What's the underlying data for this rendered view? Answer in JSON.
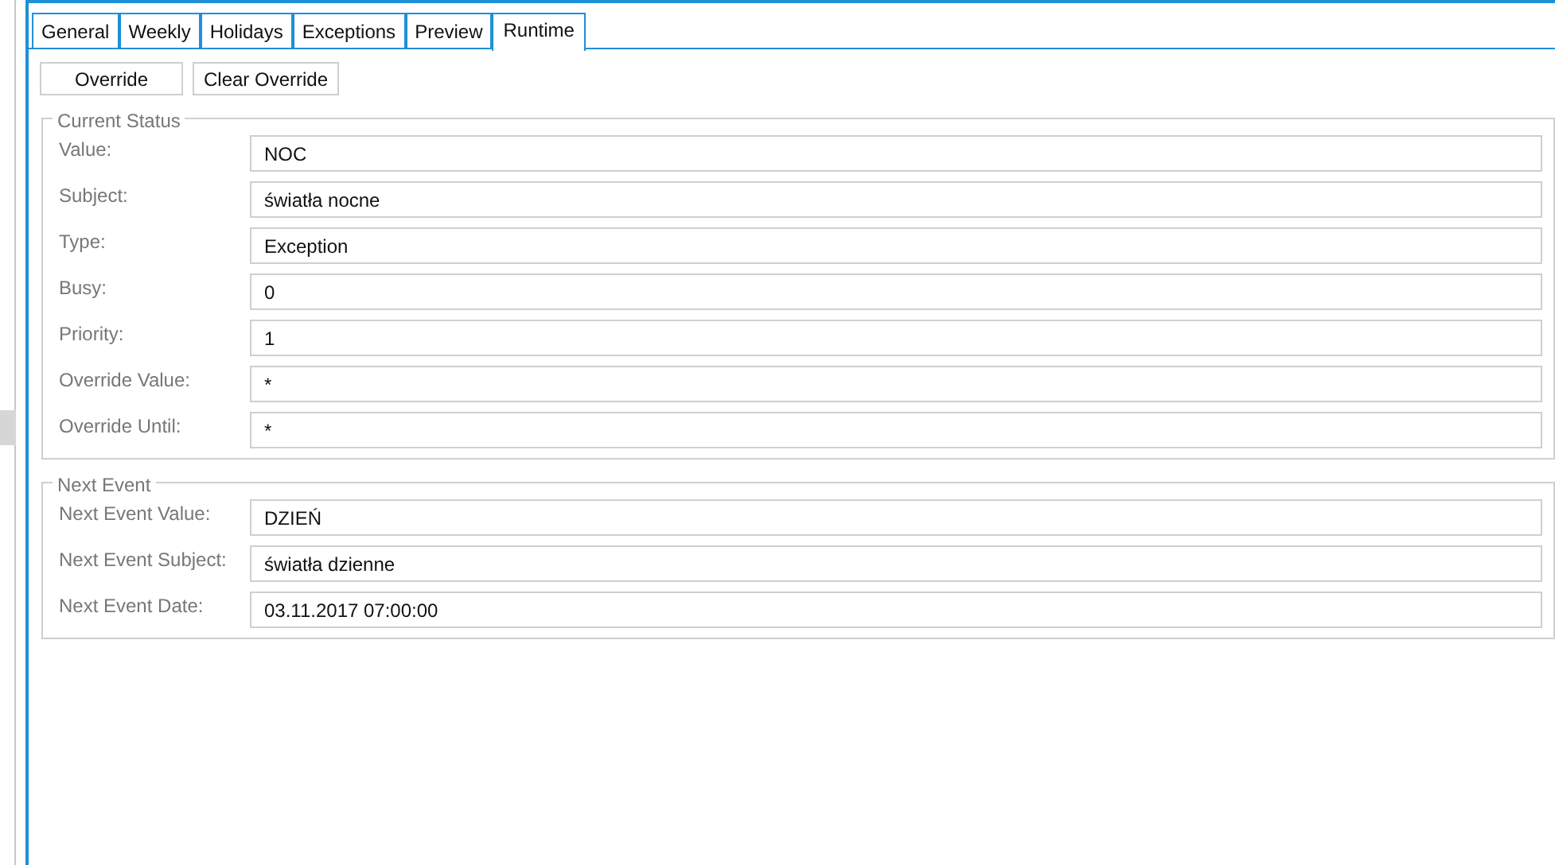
{
  "tabs": [
    {
      "label": "General",
      "selected": false
    },
    {
      "label": "Weekly",
      "selected": false
    },
    {
      "label": "Holidays",
      "selected": false
    },
    {
      "label": "Exceptions",
      "selected": false
    },
    {
      "label": "Preview",
      "selected": false
    },
    {
      "label": "Runtime",
      "selected": true
    }
  ],
  "buttons": [
    "Override",
    "Clear Override"
  ],
  "groups": [
    {
      "title": "Current Status",
      "rows": [
        {
          "label": "Value:",
          "value": "NOC"
        },
        {
          "label": "Subject:",
          "value": "światła nocne"
        },
        {
          "label": "Type:",
          "value": "Exception"
        },
        {
          "label": "Busy:",
          "value": "0"
        },
        {
          "label": "Priority:",
          "value": "1"
        },
        {
          "label": "Override Value:",
          "value": "*"
        },
        {
          "label": "Override Until:",
          "value": "*"
        }
      ]
    },
    {
      "title": "Next Event",
      "rows": [
        {
          "label": "Next Event Value:",
          "value": "DZIEŃ"
        },
        {
          "label": "Next Event Subject:",
          "value": "światła dzienne"
        },
        {
          "label": "Next Event Date:",
          "value": "03.11.2017 07:00:00"
        }
      ]
    }
  ]
}
